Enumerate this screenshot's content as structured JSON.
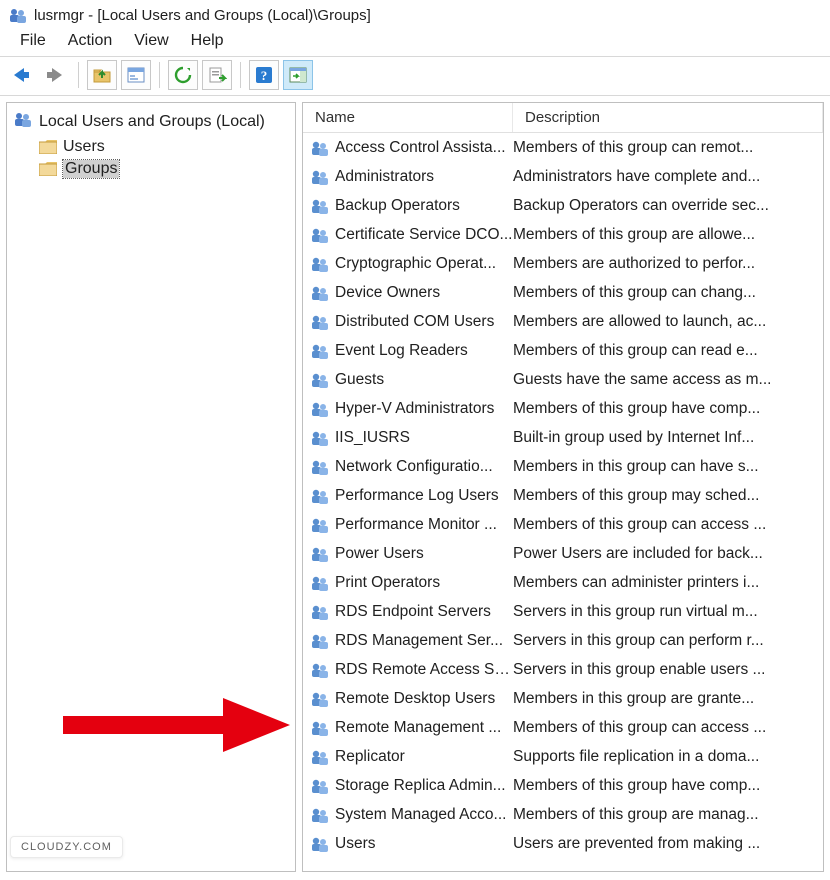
{
  "window": {
    "title": "lusrmgr - [Local Users and Groups (Local)\\Groups]"
  },
  "menu": {
    "file": "File",
    "action": "Action",
    "view": "View",
    "help": "Help"
  },
  "toolbar": {
    "back": "back",
    "forward": "forward",
    "up": "up-folder",
    "props": "properties",
    "refresh": "refresh",
    "export": "export-list",
    "help": "help",
    "showhide": "show-hide-action-pane"
  },
  "tree": {
    "root": "Local Users and Groups (Local)",
    "users": "Users",
    "groups": "Groups"
  },
  "columns": {
    "name": "Name",
    "description": "Description"
  },
  "groups": [
    {
      "name": "Access Control Assista...",
      "desc": "Members of this group can remot..."
    },
    {
      "name": "Administrators",
      "desc": "Administrators have complete and..."
    },
    {
      "name": "Backup Operators",
      "desc": "Backup Operators can override sec..."
    },
    {
      "name": "Certificate Service DCO...",
      "desc": "Members of this group are allowe..."
    },
    {
      "name": "Cryptographic Operat...",
      "desc": "Members are authorized to perfor..."
    },
    {
      "name": "Device Owners",
      "desc": "Members of this group can chang..."
    },
    {
      "name": "Distributed COM Users",
      "desc": "Members are allowed to launch, ac..."
    },
    {
      "name": "Event Log Readers",
      "desc": "Members of this group can read e..."
    },
    {
      "name": "Guests",
      "desc": "Guests have the same access as m..."
    },
    {
      "name": "Hyper-V Administrators",
      "desc": "Members of this group have comp..."
    },
    {
      "name": "IIS_IUSRS",
      "desc": "Built-in group used by Internet Inf..."
    },
    {
      "name": "Network Configuratio...",
      "desc": "Members in this group can have s..."
    },
    {
      "name": "Performance Log Users",
      "desc": "Members of this group may sched..."
    },
    {
      "name": "Performance Monitor ...",
      "desc": "Members of this group can access ..."
    },
    {
      "name": "Power Users",
      "desc": "Power Users are included for back..."
    },
    {
      "name": "Print Operators",
      "desc": "Members can administer printers i..."
    },
    {
      "name": "RDS Endpoint Servers",
      "desc": "Servers in this group run virtual m..."
    },
    {
      "name": "RDS Management Ser...",
      "desc": "Servers in this group can perform r..."
    },
    {
      "name": "RDS Remote Access Se...",
      "desc": "Servers in this group enable users ..."
    },
    {
      "name": "Remote Desktop Users",
      "desc": "Members in this group are grante..."
    },
    {
      "name": "Remote Management ...",
      "desc": "Members of this group can access ..."
    },
    {
      "name": "Replicator",
      "desc": "Supports file replication in a doma..."
    },
    {
      "name": "Storage Replica Admin...",
      "desc": "Members of this group have comp..."
    },
    {
      "name": "System Managed Acco...",
      "desc": "Members of this group are manag..."
    },
    {
      "name": "Users",
      "desc": "Users are prevented from making ..."
    }
  ],
  "watermark": "CLOUDZY.COM"
}
